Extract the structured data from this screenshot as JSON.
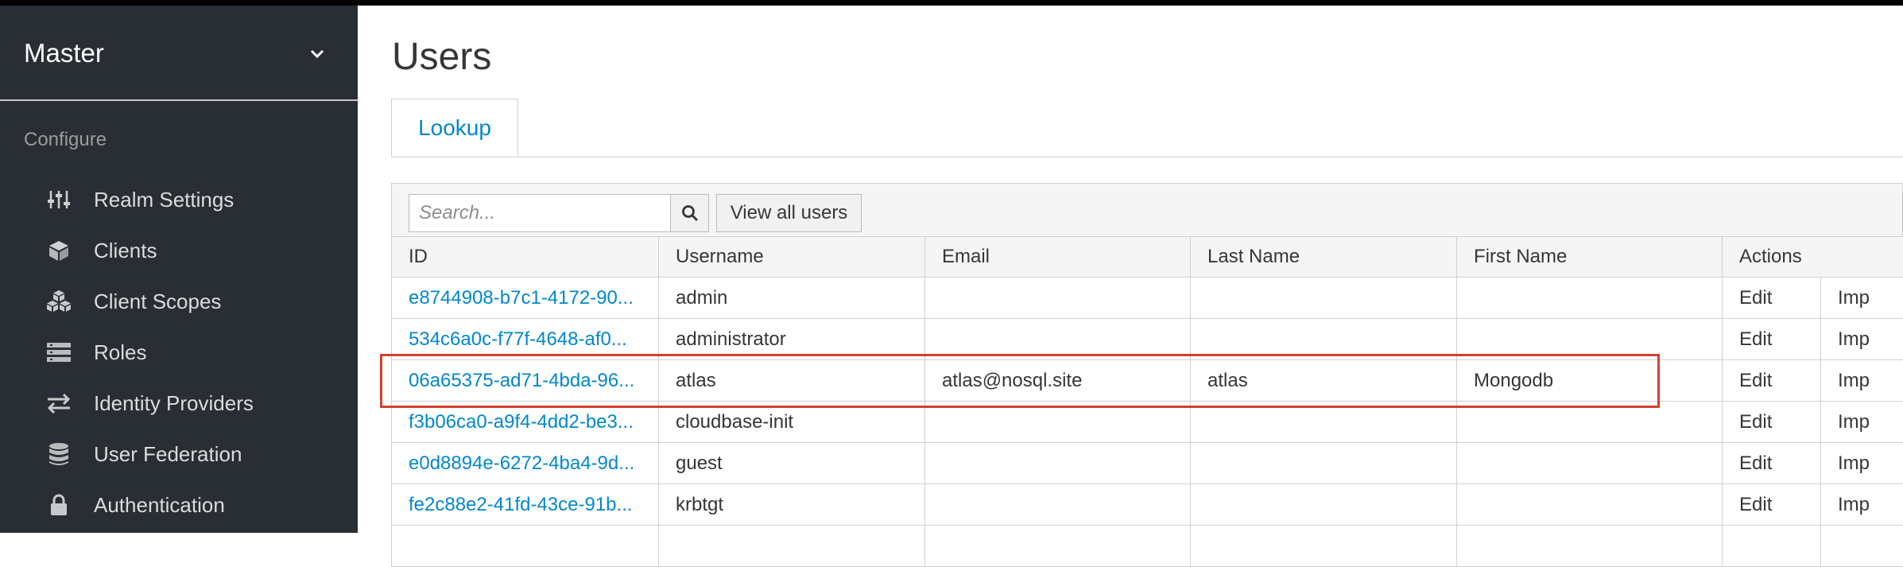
{
  "sidebar": {
    "realm": "Master",
    "section_title": "Configure",
    "items": [
      {
        "label": "Realm Settings",
        "icon": "sliders-icon"
      },
      {
        "label": "Clients",
        "icon": "cube-icon"
      },
      {
        "label": "Client Scopes",
        "icon": "cubes-icon"
      },
      {
        "label": "Roles",
        "icon": "list-icon"
      },
      {
        "label": "Identity Providers",
        "icon": "exchange-icon"
      },
      {
        "label": "User Federation",
        "icon": "database-icon"
      },
      {
        "label": "Authentication",
        "icon": "lock-icon"
      }
    ]
  },
  "main": {
    "title": "Users",
    "tabs": [
      {
        "label": "Lookup"
      }
    ],
    "search": {
      "placeholder": "Search...",
      "value": ""
    },
    "view_all_label": "View all users",
    "columns": [
      "ID",
      "Username",
      "Email",
      "Last Name",
      "First Name",
      "Actions"
    ],
    "rows": [
      {
        "id": "e8744908-b7c1-4172-90...",
        "username": "admin",
        "email": "",
        "last_name": "",
        "first_name": "",
        "action1": "Edit",
        "action2": "Imp"
      },
      {
        "id": "534c6a0c-f77f-4648-af0...",
        "username": "administrator",
        "email": "",
        "last_name": "",
        "first_name": "",
        "action1": "Edit",
        "action2": "Imp"
      },
      {
        "id": "06a65375-ad71-4bda-96...",
        "username": "atlas",
        "email": "atlas@nosql.site",
        "last_name": "atlas",
        "first_name": "Mongodb",
        "action1": "Edit",
        "action2": "Imp"
      },
      {
        "id": "f3b06ca0-a9f4-4dd2-be3...",
        "username": "cloudbase-init",
        "email": "",
        "last_name": "",
        "first_name": "",
        "action1": "Edit",
        "action2": "Imp"
      },
      {
        "id": "e0d8894e-6272-4ba4-9d...",
        "username": "guest",
        "email": "",
        "last_name": "",
        "first_name": "",
        "action1": "Edit",
        "action2": "Imp"
      },
      {
        "id": "fe2c88e2-41fd-43ce-91b...",
        "username": "krbtgt",
        "email": "",
        "last_name": "",
        "first_name": "",
        "action1": "Edit",
        "action2": "Imp"
      }
    ]
  },
  "colors": {
    "sidebar_bg": "#292e34",
    "link": "#0088ce",
    "highlight": "#d6402b"
  }
}
